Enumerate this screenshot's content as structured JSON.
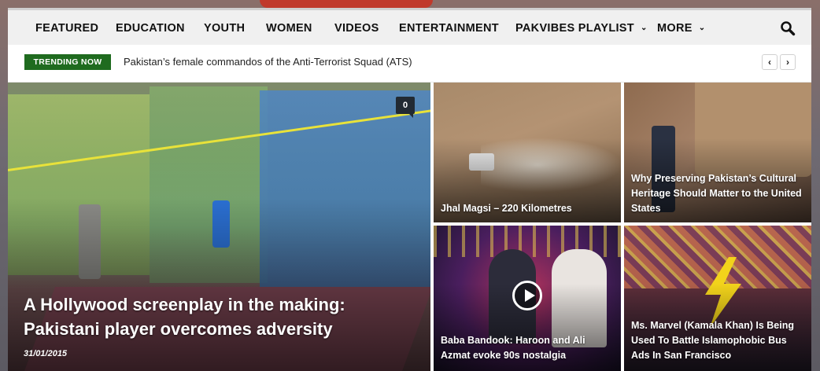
{
  "nav": {
    "items": [
      {
        "label": "FEATURED",
        "dropdown": false
      },
      {
        "label": "EDUCATION",
        "dropdown": false
      },
      {
        "label": "YOUTH",
        "dropdown": false
      },
      {
        "label": "WOMEN",
        "dropdown": false
      },
      {
        "label": "VIDEOS",
        "dropdown": false
      },
      {
        "label": "ENTERTAINMENT",
        "dropdown": false
      },
      {
        "label": "PAKVIBES PLAYLIST",
        "dropdown": true
      },
      {
        "label": "MORE",
        "dropdown": true
      }
    ],
    "search_icon": "search-icon",
    "chevron_icon": "chevron-down-icon"
  },
  "trending": {
    "badge": "TRENDING NOW",
    "headline": "Pakistan’s female commandos of the Anti-Terrorist Squad (ATS)",
    "prev_icon": "‹",
    "next_icon": "›"
  },
  "main_story": {
    "title": "A Hollywood screenplay in the making: Pakistani player overcomes adversity",
    "date": "31/01/2015",
    "comments": "0"
  },
  "tiles": [
    {
      "title": "Jhal Magsi – 220 Kilometres",
      "video": false
    },
    {
      "title": "Why Preserving Pakistan’s Cultural Heritage Should Matter to the United States",
      "video": false
    },
    {
      "title": "Baba Bandook: Haroon and Ali Azmat evoke 90s nostalgia",
      "video": true,
      "icon": "play-icon"
    },
    {
      "title": "Ms. Marvel (Kamala Khan) Is Being Used To Battle Islamophobic Bus Ads In San Francisco",
      "video": false
    }
  ],
  "colors": {
    "trending_badge": "#1f6b1f",
    "nav_background": "#f0f0f0",
    "comment_badge": "#222a33"
  }
}
